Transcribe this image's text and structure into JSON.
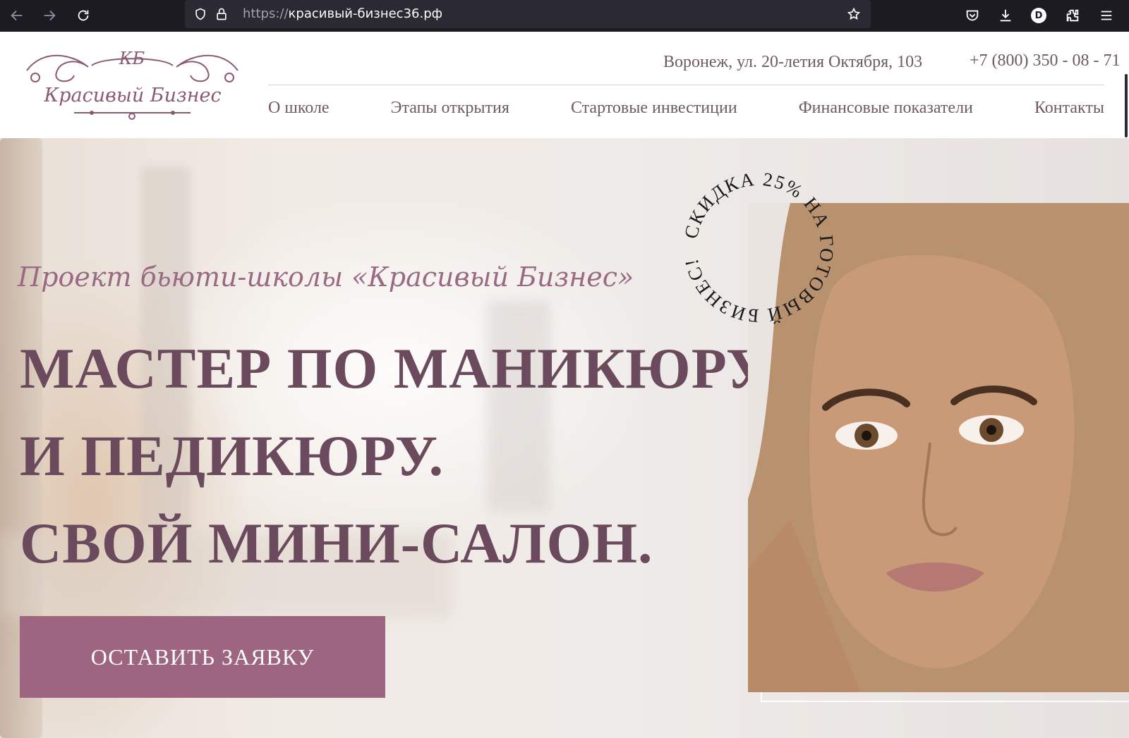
{
  "browser": {
    "url_scheme": "https://",
    "url_host": "красивый-бизнес36.рф",
    "profile_initial": "D",
    "icons": [
      "back-icon",
      "forward-icon",
      "reload-icon",
      "shield-icon",
      "lock-icon",
      "star-icon",
      "pocket-icon",
      "download-icon",
      "extensions-icon",
      "menu-icon"
    ]
  },
  "header": {
    "logo_monogram": "КБ",
    "logo_text": "Красивый Бизнес",
    "address": "Воронеж, ул. 20-летия Октября, 103",
    "phone": "+7 (800) 350 - 08 - 71"
  },
  "nav": {
    "items": [
      {
        "label": "О школе"
      },
      {
        "label": "Этапы открытия"
      },
      {
        "label": "Стартовые инвестиции"
      },
      {
        "label": "Финансовые показатели"
      },
      {
        "label": "Контакты"
      }
    ]
  },
  "hero": {
    "subtitle": "Проект бьюти-школы «Красивый Бизнес»",
    "title_lines": [
      "МАСТЕР ПО МАНИКЮРУ",
      "И ПЕДИКЮРУ.",
      "СВОЙ МИНИ-САЛОН."
    ],
    "cta_label": "ОСТАВИТЬ ЗАЯВКУ",
    "badge_text": "СКИДКА 25% НА ГОТОВЫЙ БИЗНЕС!"
  },
  "colors": {
    "accent": "#9d6580",
    "text": "#6a4a5c",
    "chrome_bg": "#1c1b22"
  }
}
